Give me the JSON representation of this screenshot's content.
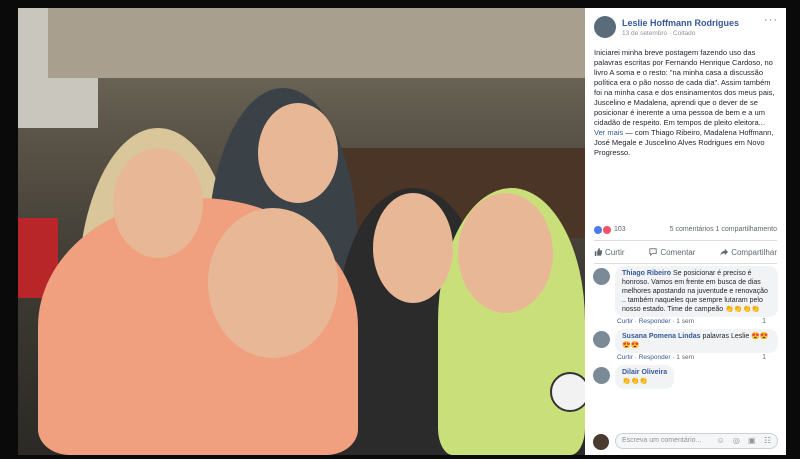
{
  "post": {
    "author": "Leslie Hoffmann Rodrigues",
    "date": "13 de setembro",
    "dot": "·",
    "privacy": "Coltado",
    "more_glyph": "···",
    "text_plain": "Iniciarei minha breve postagem fazendo uso das palavras escritas por Fernando Henrique Cardoso, no livro A soma e o resto: \"na minha casa a discussão política era o pão nosso de cada dia\". Assim também foi na minha casa e dos ensinamentos dos meus pais, Juscelino e Madalena, aprendi que o dever de se posicionar é inerente a uma pessoa de bem e a um cidadão de respeito. Em tempos de pleito eleitora... ",
    "see_more": "Ver mais",
    "with_text": " — com Thiago Ribeiro, Madalena Hoffmann, José Megale e Juscelino Alves Rodrigues em Novo Progresso."
  },
  "stats": {
    "reactions_count": "103",
    "comments_shares": "5 comentários 1 compartilhamento"
  },
  "actions": {
    "like": "Curtir",
    "comment": "Comentar",
    "share": "Compartilhar"
  },
  "comments": [
    {
      "name": "Thiago Ribeiro",
      "text": "Se posicionar é preciso é honroso. Vamos em frente em busca de dias melhores apostando na juventude e renovação .. também naqueles que sempre lutaram pelo nosso estado. Time de campeão 👏👏👏👏",
      "like": "Curtir",
      "sep": "·",
      "reply": "Responder",
      "time": "1 sem",
      "reactions": "1"
    },
    {
      "name": "Susana Pomena Lindas",
      "text": "palavras Leslie 😍😍😍😍",
      "like": "Curtir",
      "sep": "·",
      "reply": "Responder",
      "time": "1 sem",
      "reactions": "1"
    },
    {
      "name": "Dilair Oliveira",
      "text": "👏👏👏",
      "like": "",
      "sep": "",
      "reply": "",
      "time": "",
      "reactions": ""
    }
  ],
  "composer": {
    "placeholder": "Escreva um comentário...",
    "icons": "☺ ◎ ▣ ☷"
  },
  "colors": {
    "link": "#365899",
    "like_blue": "#4b7bec",
    "love_red": "#f25268"
  }
}
